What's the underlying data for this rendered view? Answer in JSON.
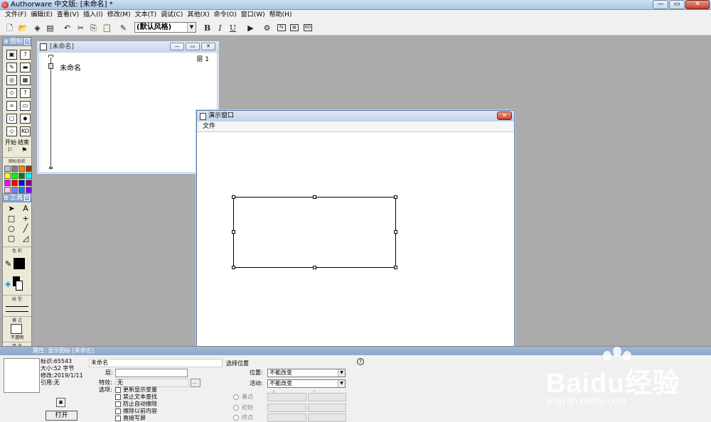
{
  "window": {
    "title": "Authorware 中文版: [未命名] *"
  },
  "menubar": [
    "文件(F)",
    "编辑(E)",
    "查看(V)",
    "插入(I)",
    "修改(M)",
    "文本(T)",
    "调试(C)",
    "其他(X)",
    "命令(O)",
    "窗口(W)",
    "帮助(H)"
  ],
  "toolbar": {
    "style_value": "(默认风格)",
    "bold": "B",
    "italic": "I",
    "underline": "U"
  },
  "icon_palette": {
    "title": "图标",
    "start_label": "开始",
    "end_label": "结束",
    "color_label": "图标色彩",
    "swatches": [
      "#c0c0c0",
      "#808080",
      "#ff8000",
      "#804000",
      "#ffff00",
      "#00ff00",
      "#008000",
      "#00ffff",
      "#ff00ff",
      "#ff0000",
      "#0000ff",
      "#800080",
      "#ffc0ff",
      "#8080ff",
      "#0080ff",
      "#8000ff",
      "#c0c0ff",
      "#000080",
      "#408080",
      "#ff80c0"
    ]
  },
  "tools_palette": {
    "title": "工具",
    "color_label": "色 彩",
    "line_label": "线 型",
    "mode_label": "模 式",
    "mode_value": "不透明",
    "fill_label": "填 充",
    "fill_value": "无"
  },
  "flow_window": {
    "title": "[未命名]",
    "layer": "层 1",
    "node_label": "未命名"
  },
  "presentation": {
    "title": "演示窗口",
    "menu_file": "文件"
  },
  "properties": {
    "title": "属性: 显示图标 [未命名]",
    "id": "标识:65543",
    "size": "大小:52 字节",
    "modified": "修改:2019/1/11",
    "ref": "引用:无",
    "open_button": "打开",
    "name_value": "未命名",
    "layer_label": "层:",
    "effect_label": "特效:",
    "effect_value": "无",
    "options_label": "选项:",
    "options": [
      "更新显示变量",
      "禁止文本查找",
      "防止自动擦除",
      "擦除以前内容",
      "直接写屏"
    ],
    "position_header": "选择位置",
    "position_label": "位置:",
    "position_value": "不能改变",
    "active_label": "活动:",
    "active_value": "不能改变",
    "radios": [
      "基点",
      "初始",
      "终点"
    ],
    "x_label": "X",
    "y_label": "Y"
  },
  "watermark": {
    "brand": "Baidu经验",
    "url": "jingyan.baidu.com"
  }
}
